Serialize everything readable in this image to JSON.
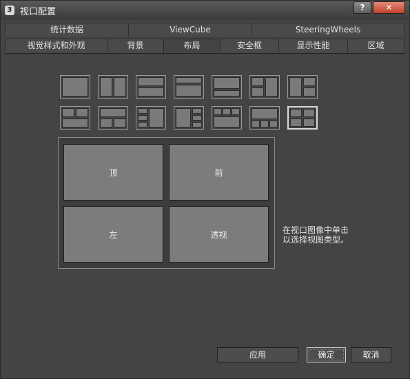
{
  "window": {
    "title": "视口配置",
    "app_icon": "3ds-max-icon",
    "help_label": "?",
    "close_label": "✕"
  },
  "tabs": {
    "row1": [
      {
        "label": "统计数据"
      },
      {
        "label": "ViewCube"
      },
      {
        "label": "SteeringWheels"
      }
    ],
    "row2": [
      {
        "label": "视觉样式和外观"
      },
      {
        "label": "背景"
      },
      {
        "label": "布局",
        "active": true
      },
      {
        "label": "安全框"
      },
      {
        "label": "显示性能"
      },
      {
        "label": "区域"
      }
    ]
  },
  "layouts": {
    "count": 14,
    "selected": "2x2 grid"
  },
  "preview": {
    "top_left": "顶",
    "top_right": "前",
    "bottom_left": "左",
    "bottom_right": "透视"
  },
  "hint": {
    "line1": "在视口图像中单击",
    "line2": "以选择视图类型。"
  },
  "buttons": {
    "apply": "应用",
    "ok": "确定",
    "cancel": "取消"
  },
  "colors": {
    "background": "#444444",
    "viewport": "#7c7c7c",
    "close_button": "#c2412b"
  }
}
